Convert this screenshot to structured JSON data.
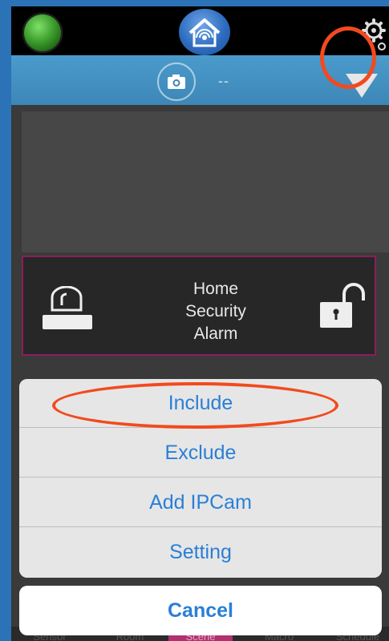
{
  "camera_bar": {
    "value": "--"
  },
  "alarm": {
    "label": "Home\nSecurity\nAlarm"
  },
  "action_sheet": {
    "items": [
      {
        "label": "Include"
      },
      {
        "label": "Exclude"
      },
      {
        "label": "Add IPCam"
      },
      {
        "label": "Setting"
      }
    ],
    "cancel": "Cancel"
  },
  "tabbar": {
    "tabs": [
      "Sensor",
      "Room",
      "Scene",
      "Macro",
      "Schedule"
    ],
    "active": "Scene"
  },
  "colors": {
    "accent": "#2a7fd6",
    "highlight": "#f24a1e",
    "camera_bar": "#4a9bcc",
    "alarm_border": "#8a1e5c",
    "active_tab": "#b03070"
  },
  "icons": [
    "status-led-icon",
    "home-wifi-icon",
    "gear-icon",
    "camera-icon",
    "dropdown-triangle-icon",
    "siren-icon",
    "unlocked-padlock-icon"
  ]
}
